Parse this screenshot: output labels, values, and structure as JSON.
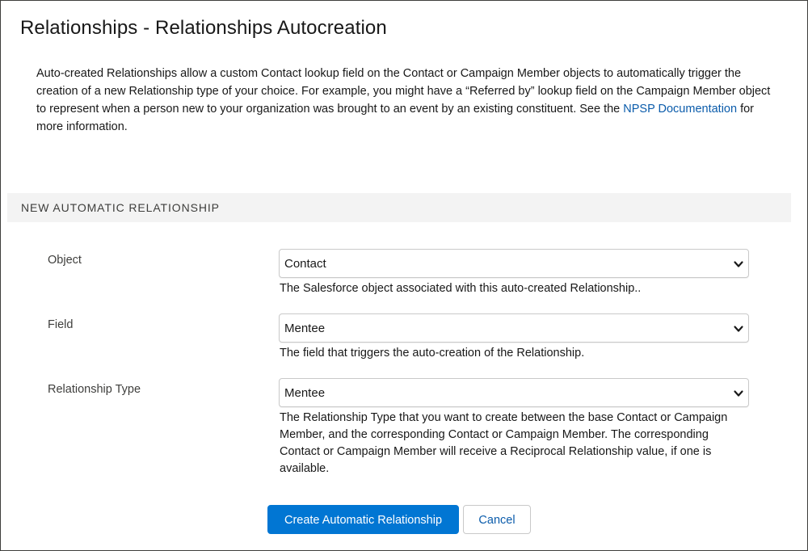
{
  "page": {
    "title": "Relationships - Relationships Autocreation"
  },
  "intro": {
    "text_before_link": "Auto-created Relationships allow a custom Contact lookup field on the Contact or Campaign Member objects to automatically trigger the creation of a new Relationship type of your choice. For example, you might have a “Referred by” lookup field on the Campaign Member object to represent when a person new to your organization was brought to an event by an existing constituent. See the ",
    "link_text": "NPSP Documentation",
    "text_after_link": " for more information."
  },
  "section": {
    "header": "NEW AUTOMATIC RELATIONSHIP"
  },
  "form": {
    "object": {
      "label": "Object",
      "value": "Contact",
      "help": "The Salesforce object associated with this auto-created Relationship.."
    },
    "field": {
      "label": "Field",
      "value": "Mentee",
      "help": "The field that triggers the auto-creation of the Relationship."
    },
    "relationship_type": {
      "label": "Relationship Type",
      "value": "Mentee",
      "help": "The Relationship Type that you want to create between the base Contact or Campaign Member, and the corresponding Contact or Campaign Member. The corresponding Contact or Campaign Member will receive a Reciprocal Relationship value, if one is available."
    }
  },
  "actions": {
    "create_label": "Create Automatic Relationship",
    "cancel_label": "Cancel"
  },
  "colors": {
    "brand": "#0176d3",
    "link": "#0b5cab",
    "section_bg": "#f3f3f3",
    "border": "#c9c9c9"
  },
  "icons": {
    "select_chevron": "chevron-down-icon"
  }
}
